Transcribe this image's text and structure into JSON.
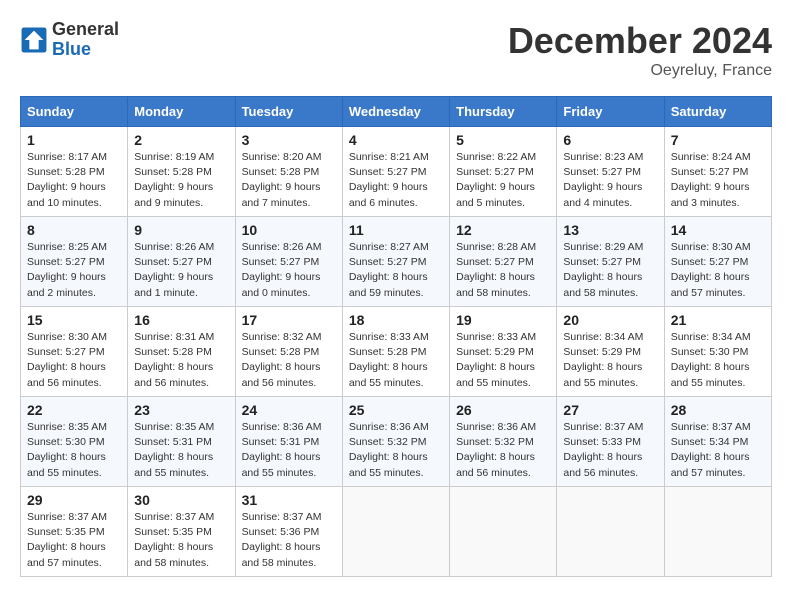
{
  "logo": {
    "general": "General",
    "blue": "Blue"
  },
  "title": "December 2024",
  "location": "Oeyreluy, France",
  "weekdays": [
    "Sunday",
    "Monday",
    "Tuesday",
    "Wednesday",
    "Thursday",
    "Friday",
    "Saturday"
  ],
  "weeks": [
    [
      {
        "day": "1",
        "sunrise": "8:17 AM",
        "sunset": "5:28 PM",
        "daylight": "9 hours and 10 minutes."
      },
      {
        "day": "2",
        "sunrise": "8:19 AM",
        "sunset": "5:28 PM",
        "daylight": "9 hours and 9 minutes."
      },
      {
        "day": "3",
        "sunrise": "8:20 AM",
        "sunset": "5:28 PM",
        "daylight": "9 hours and 7 minutes."
      },
      {
        "day": "4",
        "sunrise": "8:21 AM",
        "sunset": "5:27 PM",
        "daylight": "9 hours and 6 minutes."
      },
      {
        "day": "5",
        "sunrise": "8:22 AM",
        "sunset": "5:27 PM",
        "daylight": "9 hours and 5 minutes."
      },
      {
        "day": "6",
        "sunrise": "8:23 AM",
        "sunset": "5:27 PM",
        "daylight": "9 hours and 4 minutes."
      },
      {
        "day": "7",
        "sunrise": "8:24 AM",
        "sunset": "5:27 PM",
        "daylight": "9 hours and 3 minutes."
      }
    ],
    [
      {
        "day": "8",
        "sunrise": "8:25 AM",
        "sunset": "5:27 PM",
        "daylight": "9 hours and 2 minutes."
      },
      {
        "day": "9",
        "sunrise": "8:26 AM",
        "sunset": "5:27 PM",
        "daylight": "9 hours and 1 minute."
      },
      {
        "day": "10",
        "sunrise": "8:26 AM",
        "sunset": "5:27 PM",
        "daylight": "9 hours and 0 minutes."
      },
      {
        "day": "11",
        "sunrise": "8:27 AM",
        "sunset": "5:27 PM",
        "daylight": "8 hours and 59 minutes."
      },
      {
        "day": "12",
        "sunrise": "8:28 AM",
        "sunset": "5:27 PM",
        "daylight": "8 hours and 58 minutes."
      },
      {
        "day": "13",
        "sunrise": "8:29 AM",
        "sunset": "5:27 PM",
        "daylight": "8 hours and 58 minutes."
      },
      {
        "day": "14",
        "sunrise": "8:30 AM",
        "sunset": "5:27 PM",
        "daylight": "8 hours and 57 minutes."
      }
    ],
    [
      {
        "day": "15",
        "sunrise": "8:30 AM",
        "sunset": "5:27 PM",
        "daylight": "8 hours and 56 minutes."
      },
      {
        "day": "16",
        "sunrise": "8:31 AM",
        "sunset": "5:28 PM",
        "daylight": "8 hours and 56 minutes."
      },
      {
        "day": "17",
        "sunrise": "8:32 AM",
        "sunset": "5:28 PM",
        "daylight": "8 hours and 56 minutes."
      },
      {
        "day": "18",
        "sunrise": "8:33 AM",
        "sunset": "5:28 PM",
        "daylight": "8 hours and 55 minutes."
      },
      {
        "day": "19",
        "sunrise": "8:33 AM",
        "sunset": "5:29 PM",
        "daylight": "8 hours and 55 minutes."
      },
      {
        "day": "20",
        "sunrise": "8:34 AM",
        "sunset": "5:29 PM",
        "daylight": "8 hours and 55 minutes."
      },
      {
        "day": "21",
        "sunrise": "8:34 AM",
        "sunset": "5:30 PM",
        "daylight": "8 hours and 55 minutes."
      }
    ],
    [
      {
        "day": "22",
        "sunrise": "8:35 AM",
        "sunset": "5:30 PM",
        "daylight": "8 hours and 55 minutes."
      },
      {
        "day": "23",
        "sunrise": "8:35 AM",
        "sunset": "5:31 PM",
        "daylight": "8 hours and 55 minutes."
      },
      {
        "day": "24",
        "sunrise": "8:36 AM",
        "sunset": "5:31 PM",
        "daylight": "8 hours and 55 minutes."
      },
      {
        "day": "25",
        "sunrise": "8:36 AM",
        "sunset": "5:32 PM",
        "daylight": "8 hours and 55 minutes."
      },
      {
        "day": "26",
        "sunrise": "8:36 AM",
        "sunset": "5:32 PM",
        "daylight": "8 hours and 56 minutes."
      },
      {
        "day": "27",
        "sunrise": "8:37 AM",
        "sunset": "5:33 PM",
        "daylight": "8 hours and 56 minutes."
      },
      {
        "day": "28",
        "sunrise": "8:37 AM",
        "sunset": "5:34 PM",
        "daylight": "8 hours and 57 minutes."
      }
    ],
    [
      {
        "day": "29",
        "sunrise": "8:37 AM",
        "sunset": "5:35 PM",
        "daylight": "8 hours and 57 minutes."
      },
      {
        "day": "30",
        "sunrise": "8:37 AM",
        "sunset": "5:35 PM",
        "daylight": "8 hours and 58 minutes."
      },
      {
        "day": "31",
        "sunrise": "8:37 AM",
        "sunset": "5:36 PM",
        "daylight": "8 hours and 58 minutes."
      },
      null,
      null,
      null,
      null
    ]
  ]
}
